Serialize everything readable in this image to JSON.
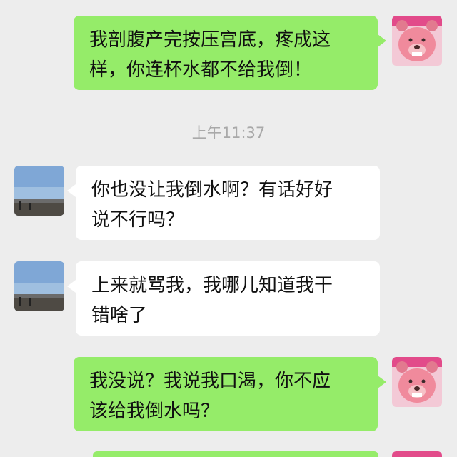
{
  "messages": [
    {
      "side": "out",
      "lines": [
        "我剖腹产完按压宫底，疼成这",
        "样，你连杯水都不给我倒！"
      ],
      "avatar": "pink-teddy-bear-avatar"
    },
    {
      "side": "in",
      "lines": [
        "你也没让我倒水啊？有话好好",
        "说不行吗？"
      ],
      "avatar": "seaside-landscape-avatar"
    },
    {
      "side": "in",
      "lines": [
        "上来就骂我，我哪儿知道我干",
        "错啥了"
      ],
      "avatar": "seaside-landscape-avatar"
    },
    {
      "side": "out",
      "lines": [
        "我没说？我说我口渴，你不应",
        "该给我倒水吗？"
      ],
      "avatar": "pink-teddy-bear-avatar"
    }
  ],
  "timestamp": "上午11:37",
  "colors": {
    "background": "#ededed",
    "outgoing_bubble": "#95ec69",
    "incoming_bubble": "#ffffff",
    "timestamp_text": "#a9a9a9"
  }
}
